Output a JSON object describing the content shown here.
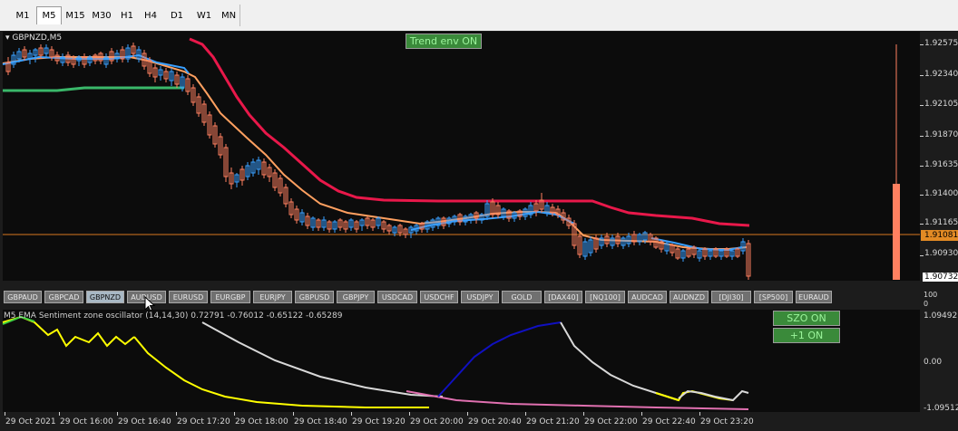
{
  "timeframes": [
    "M1",
    "M5",
    "M15",
    "M30",
    "H1",
    "H4",
    "D1",
    "W1",
    "MN"
  ],
  "active_timeframe": "M5",
  "chart": {
    "symbol_label": "GBPNZD,M5",
    "trend_env_label": "Trend env ON",
    "price_ticks": [
      "1.92575",
      "1.92340",
      "1.92105",
      "1.91870",
      "1.91635",
      "1.91400",
      "1.91165",
      "1.90930",
      "1.90732"
    ],
    "current_price": "1.91081"
  },
  "symbol_buttons": [
    "GBPAUD",
    "GBPCAD",
    "GBPNZD",
    "AUDUSD",
    "EURUSD",
    "EURGBP",
    "EURJPY",
    "GBPUSD",
    "GBPJPY",
    "USDCAD",
    "USDCHF",
    "USDJPY",
    "GOLD",
    "[DAX40]",
    "[NQ100]",
    "AUDCAD",
    "AUDNZD",
    "[DJI30]",
    "[SP500]",
    "EURAUD"
  ],
  "selected_symbol": "GBPNZD",
  "scale_gap": {
    "top": "100",
    "bottom": "0"
  },
  "oscillator": {
    "label": "M5 EMA Sentiment zone oscillator (14,14,30) 0.72791 -0.76012 -0.65122 -0.65289",
    "ticks": [
      "1.09492",
      "0.00",
      "-1.09512"
    ],
    "szo_label": "SZO ON",
    "plus_one_label": "+1 ON"
  },
  "time_labels": [
    "29 Oct 2021",
    "29 Oct 16:00",
    "29 Oct 16:40",
    "29 Oct 17:20",
    "29 Oct 18:00",
    "29 Oct 18:40",
    "29 Oct 19:20",
    "29 Oct 20:00",
    "29 Oct 20:40",
    "29 Oct 21:20",
    "29 Oct 22:00",
    "29 Oct 22:40",
    "29 Oct 23:20"
  ],
  "colors": {
    "env_upper": "#e8184a",
    "env_lower": "#3ab86a",
    "ema": "#ffa060",
    "price_line": "#d87820",
    "candle_bear": "#ff8060",
    "candle_bull": "#3aa0ff",
    "osc_grey": "#d8d8d8",
    "osc_yellow": "#ffff00",
    "osc_pink": "#e070b0",
    "osc_blue": "#1010c0",
    "osc_green": "#40d040"
  }
}
